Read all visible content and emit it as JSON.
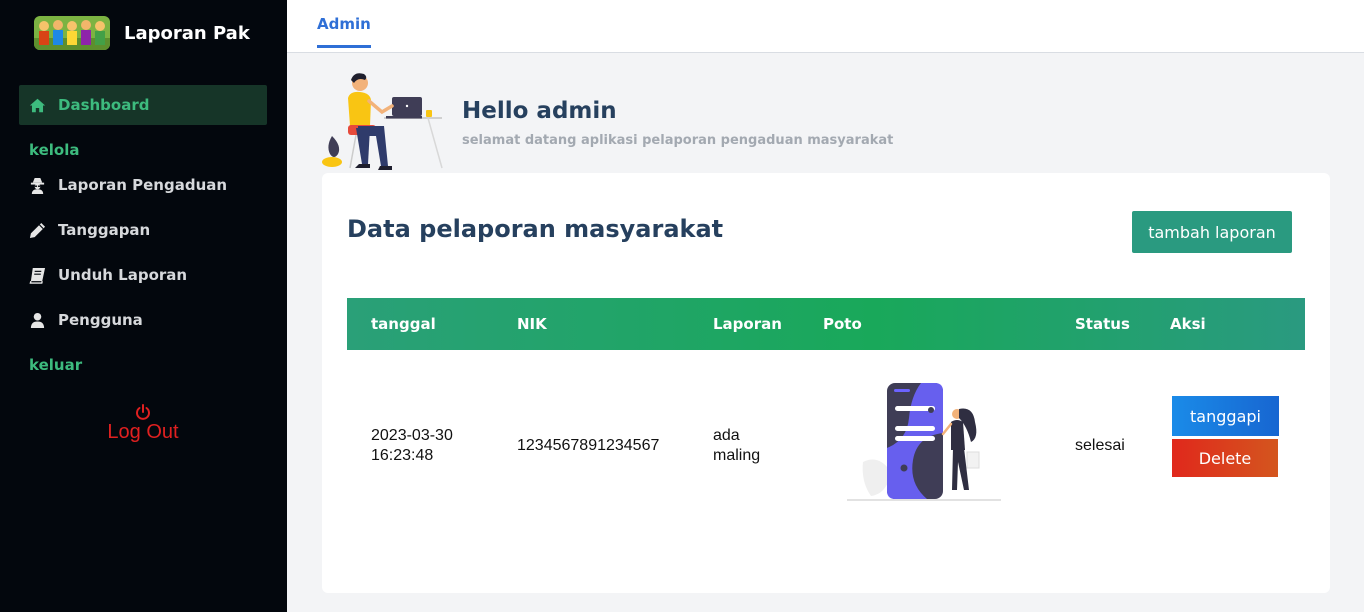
{
  "app": {
    "brand_name": "Laporan Pak",
    "logo_icon": "people-group-logo"
  },
  "sidebar": {
    "active_item": {
      "label": "Dashboard",
      "icon": "home-icon"
    },
    "section_kelola": "kelola",
    "items": [
      {
        "label": "Laporan Pengaduan",
        "icon": "user-secret-icon"
      },
      {
        "label": "Tanggapan",
        "icon": "pencil-icon"
      },
      {
        "label": "Unduh Laporan",
        "icon": "book-icon"
      },
      {
        "label": "Pengguna",
        "icon": "user-icon"
      }
    ],
    "section_keluar": "keluar",
    "logout_label": "Log Out",
    "accent_color": "#3dbb7e",
    "logout_color": "#e02020"
  },
  "topbar": {
    "tab_label": "Admin"
  },
  "greeting": {
    "title": "Hello admin",
    "subtitle": "selamat datang aplikasi pelaporan pengaduan masyarakat"
  },
  "card": {
    "title": "Data pelaporan masyarakat",
    "add_button": "tambah laporan"
  },
  "table": {
    "headers": [
      "tanggal",
      "NIK",
      "Laporan",
      "Poto",
      "Status",
      "Aksi"
    ],
    "rows": [
      {
        "tanggal_date": "2023-03-30",
        "tanggal_time": "16:23:48",
        "nik": "1234567891234567",
        "laporan_line1": "ada",
        "laporan_line2": "maling",
        "status": "selesai",
        "action_respond": "tanggapi",
        "action_delete": "Delete"
      }
    ]
  }
}
